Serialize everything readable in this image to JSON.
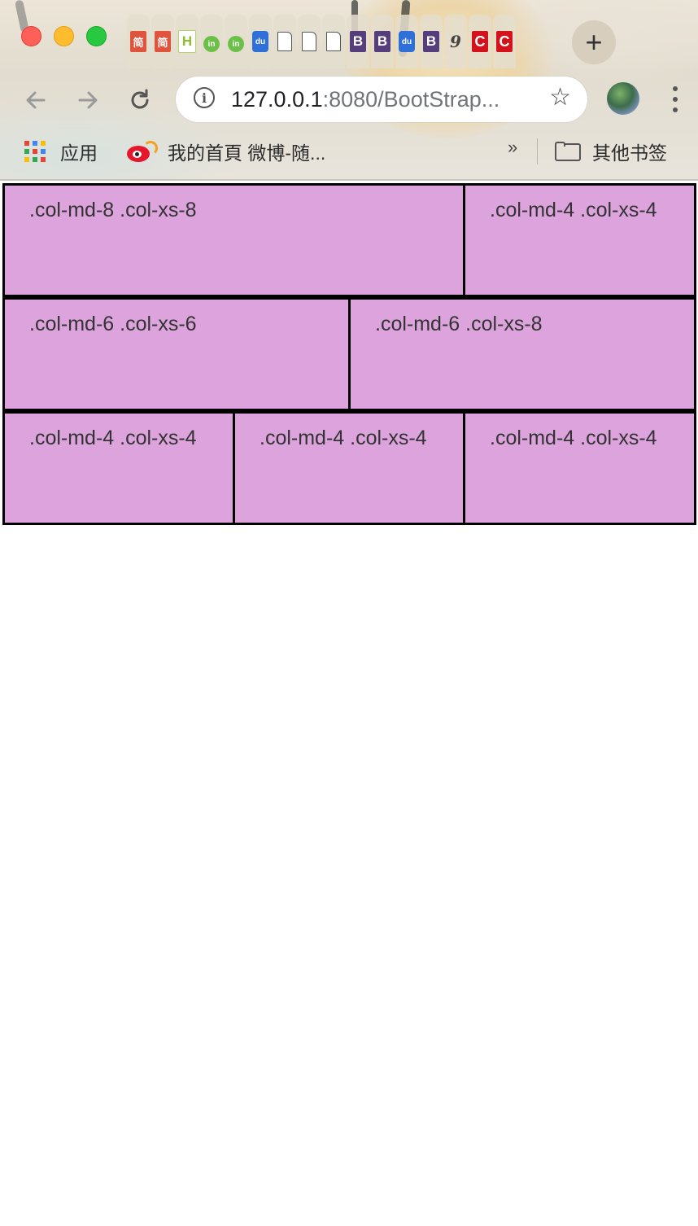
{
  "browser": {
    "new_tab_label": "+",
    "tabs": [
      {
        "icon": "jian-favicon",
        "glyph": "简"
      },
      {
        "icon": "jian-favicon",
        "glyph": "简"
      },
      {
        "icon": "h-favicon",
        "glyph": "H"
      },
      {
        "icon": "in-favicon",
        "glyph": "in"
      },
      {
        "icon": "in-favicon",
        "glyph": "in"
      },
      {
        "icon": "baidu-favicon",
        "glyph": "du"
      },
      {
        "icon": "document-icon",
        "glyph": ""
      },
      {
        "icon": "document-icon",
        "glyph": ""
      },
      {
        "icon": "document-icon",
        "glyph": ""
      },
      {
        "icon": "bootstrap-favicon",
        "glyph": "B"
      },
      {
        "icon": "bootstrap-favicon",
        "glyph": "B"
      },
      {
        "icon": "baidu-favicon",
        "glyph": "du"
      },
      {
        "icon": "bootstrap-favicon",
        "glyph": "B"
      },
      {
        "icon": "nine-favicon",
        "glyph": "9"
      },
      {
        "icon": "c-favicon",
        "glyph": "C"
      },
      {
        "icon": "c-favicon",
        "glyph": "C"
      }
    ],
    "address": {
      "host": "127.0.0.1",
      "rest": ":8080/BootStrap..."
    },
    "bookmarks": {
      "apps_label": "应用",
      "weibo_label": "我的首頁 微博-随...",
      "overflow_label": "»",
      "other_label": "其他书签"
    },
    "colors": {
      "apps_grid": [
        "#ea4335",
        "#4285f4",
        "#fbbc05",
        "#34a853",
        "#ea4335",
        "#4285f4",
        "#fbbc05",
        "#34a853",
        "#ea4335"
      ]
    }
  },
  "grid": {
    "rows": [
      {
        "cols": [
          {
            "text": ".col-md-8 .col-xs-8"
          },
          {
            "text": ".col-md-4 .col-xs-4"
          }
        ]
      },
      {
        "cols": [
          {
            "text": ".col-md-6 .col-xs-6"
          },
          {
            "text": ".col-md-6 .col-xs-8"
          }
        ]
      },
      {
        "cols": [
          {
            "text": ".col-md-4 .col-xs-4"
          },
          {
            "text": ".col-md-4 .col-xs-4"
          },
          {
            "text": ".col-md-4 .col-xs-4"
          }
        ]
      }
    ],
    "colors": {
      "cell_bg": "#dca3dc",
      "border": "#000000",
      "text": "#333333"
    }
  }
}
